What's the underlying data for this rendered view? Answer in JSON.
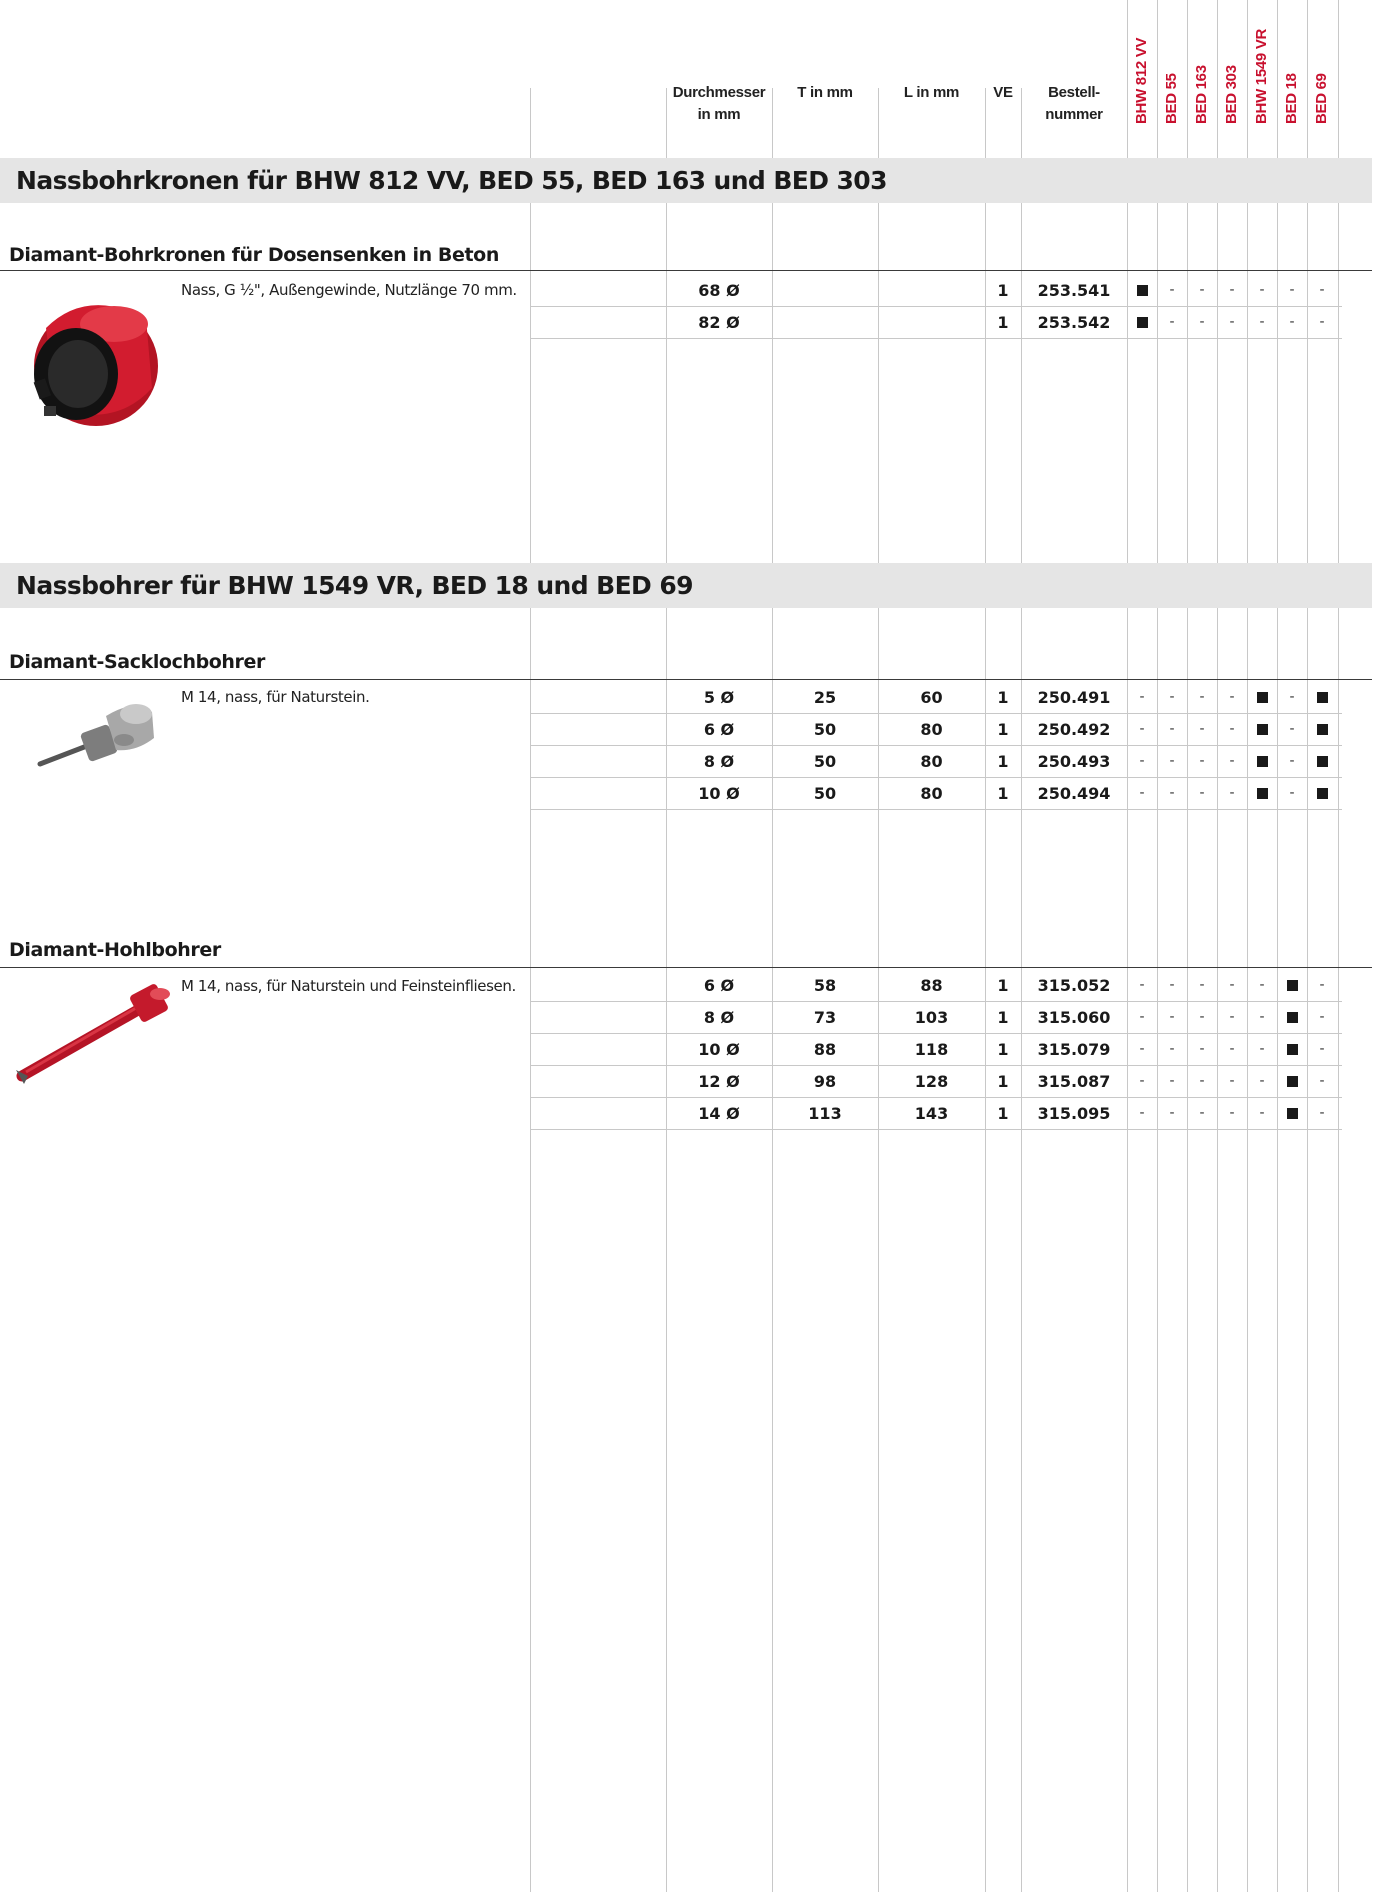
{
  "columns": {
    "durchmesser": [
      "Durchmesser",
      "in mm"
    ],
    "t": "T in mm",
    "l": "L in mm",
    "ve": "VE",
    "bestell": [
      "Bestell-",
      "nummer"
    ],
    "machines": [
      "BHW 812 VV",
      "BED 55",
      "BED 163",
      "BED 303",
      "BHW 1549 VR",
      "BED 18",
      "BED 69"
    ]
  },
  "sections": [
    {
      "title": "Nassbohrkronen für BHW 812 VV, BED 55, BED 163 und BED 303",
      "groups": [
        {
          "title": "Diamant-Bohrkronen für Dosensenken in Beton",
          "image": "core-drill-bit-image",
          "description": "Nass, G ½\", Außengewinde, Nutzlänge 70 mm.",
          "rows": [
            {
              "d": "68 Ø",
              "t": "",
              "l": "",
              "ve": "1",
              "nr": "253.541",
              "m": [
                "■",
                "-",
                "-",
                "-",
                "-",
                "-",
                "-"
              ]
            },
            {
              "d": "82 Ø",
              "t": "",
              "l": "",
              "ve": "1",
              "nr": "253.542",
              "m": [
                "■",
                "-",
                "-",
                "-",
                "-",
                "-",
                "-"
              ]
            }
          ]
        }
      ]
    },
    {
      "title": "Nassbohrer für BHW 1549 VR, BED 18 und BED 69",
      "groups": [
        {
          "title": "Diamant-Sacklochbohrer",
          "image": "blind-hole-drill-image",
          "description": "M 14, nass, für Naturstein.",
          "rows": [
            {
              "d": "5 Ø",
              "t": "25",
              "l": "60",
              "ve": "1",
              "nr": "250.491",
              "m": [
                "-",
                "-",
                "-",
                "-",
                "■",
                "-",
                "■"
              ]
            },
            {
              "d": "6 Ø",
              "t": "50",
              "l": "80",
              "ve": "1",
              "nr": "250.492",
              "m": [
                "-",
                "-",
                "-",
                "-",
                "■",
                "-",
                "■"
              ]
            },
            {
              "d": "8 Ø",
              "t": "50",
              "l": "80",
              "ve": "1",
              "nr": "250.493",
              "m": [
                "-",
                "-",
                "-",
                "-",
                "■",
                "-",
                "■"
              ]
            },
            {
              "d": "10 Ø",
              "t": "50",
              "l": "80",
              "ve": "1",
              "nr": "250.494",
              "m": [
                "-",
                "-",
                "-",
                "-",
                "■",
                "-",
                "■"
              ]
            }
          ]
        },
        {
          "title": "Diamant-Hohlbohrer",
          "image": "hollow-drill-image",
          "description": "M 14, nass, für Naturstein und Feinsteinfliesen.",
          "rows": [
            {
              "d": "6 Ø",
              "t": "58",
              "l": "88",
              "ve": "1",
              "nr": "315.052",
              "m": [
                "-",
                "-",
                "-",
                "-",
                "-",
                "■",
                "-"
              ]
            },
            {
              "d": "8 Ø",
              "t": "73",
              "l": "103",
              "ve": "1",
              "nr": "315.060",
              "m": [
                "-",
                "-",
                "-",
                "-",
                "-",
                "■",
                "-"
              ]
            },
            {
              "d": "10 Ø",
              "t": "88",
              "l": "118",
              "ve": "1",
              "nr": "315.079",
              "m": [
                "-",
                "-",
                "-",
                "-",
                "-",
                "■",
                "-"
              ]
            },
            {
              "d": "12 Ø",
              "t": "98",
              "l": "128",
              "ve": "1",
              "nr": "315.087",
              "m": [
                "-",
                "-",
                "-",
                "-",
                "-",
                "■",
                "-"
              ]
            },
            {
              "d": "14 Ø",
              "t": "113",
              "l": "143",
              "ve": "1",
              "nr": "315.095",
              "m": [
                "-",
                "-",
                "-",
                "-",
                "-",
                "■",
                "-"
              ]
            }
          ]
        }
      ]
    }
  ],
  "colors": {
    "accent": "#c8102e",
    "band": "#e5e5e5",
    "drill_red": "#c81a2c"
  }
}
